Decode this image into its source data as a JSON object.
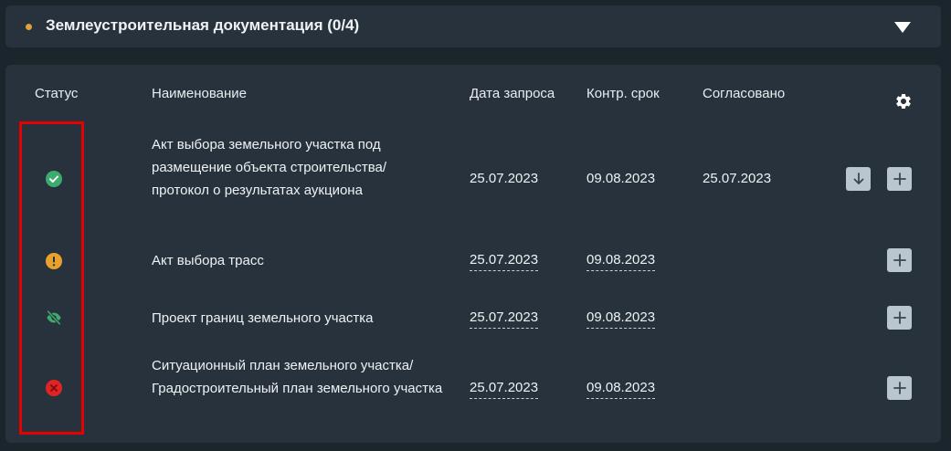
{
  "section": {
    "title": "Землеустроительная документация (0/4)",
    "dot_color": "#e0a13a"
  },
  "table": {
    "headers": {
      "status": "Статус",
      "name": "Наименование",
      "request_date": "Дата запроса",
      "deadline": "Контр. срок",
      "approved": "Согласовано"
    },
    "rows": [
      {
        "status": "approved",
        "status_icon": "check-circle-icon",
        "status_color": "#3dab6e",
        "name": "Акт выбора земельного участка под размещение объекта строительства/протокол о результатах аукциона",
        "request_date": "25.07.2023",
        "deadline": "09.08.2023",
        "approved": "25.07.2023"
      },
      {
        "status": "warning",
        "status_icon": "exclamation-circle-icon",
        "status_color": "#e8a12c",
        "name": "Акт выбора трасс",
        "request_date": "25.07.2023",
        "deadline": "09.08.2023",
        "approved": ""
      },
      {
        "status": "hidden",
        "status_icon": "eye-off-icon",
        "status_color": "#3dab6e",
        "name": "Проект границ земельного участка",
        "request_date": "25.07.2023",
        "deadline": "09.08.2023",
        "approved": ""
      },
      {
        "status": "rejected",
        "status_icon": "x-circle-icon",
        "status_color": "#e02424",
        "name": "Ситуационный план земельного участка/Градостроительный план земельного участка",
        "request_date": "25.07.2023",
        "deadline": "09.08.2023",
        "approved": ""
      }
    ]
  },
  "colors": {
    "background": "#1c242c",
    "panel": "#28323c",
    "button": "#b9c5cf",
    "highlight": "#e60000"
  }
}
